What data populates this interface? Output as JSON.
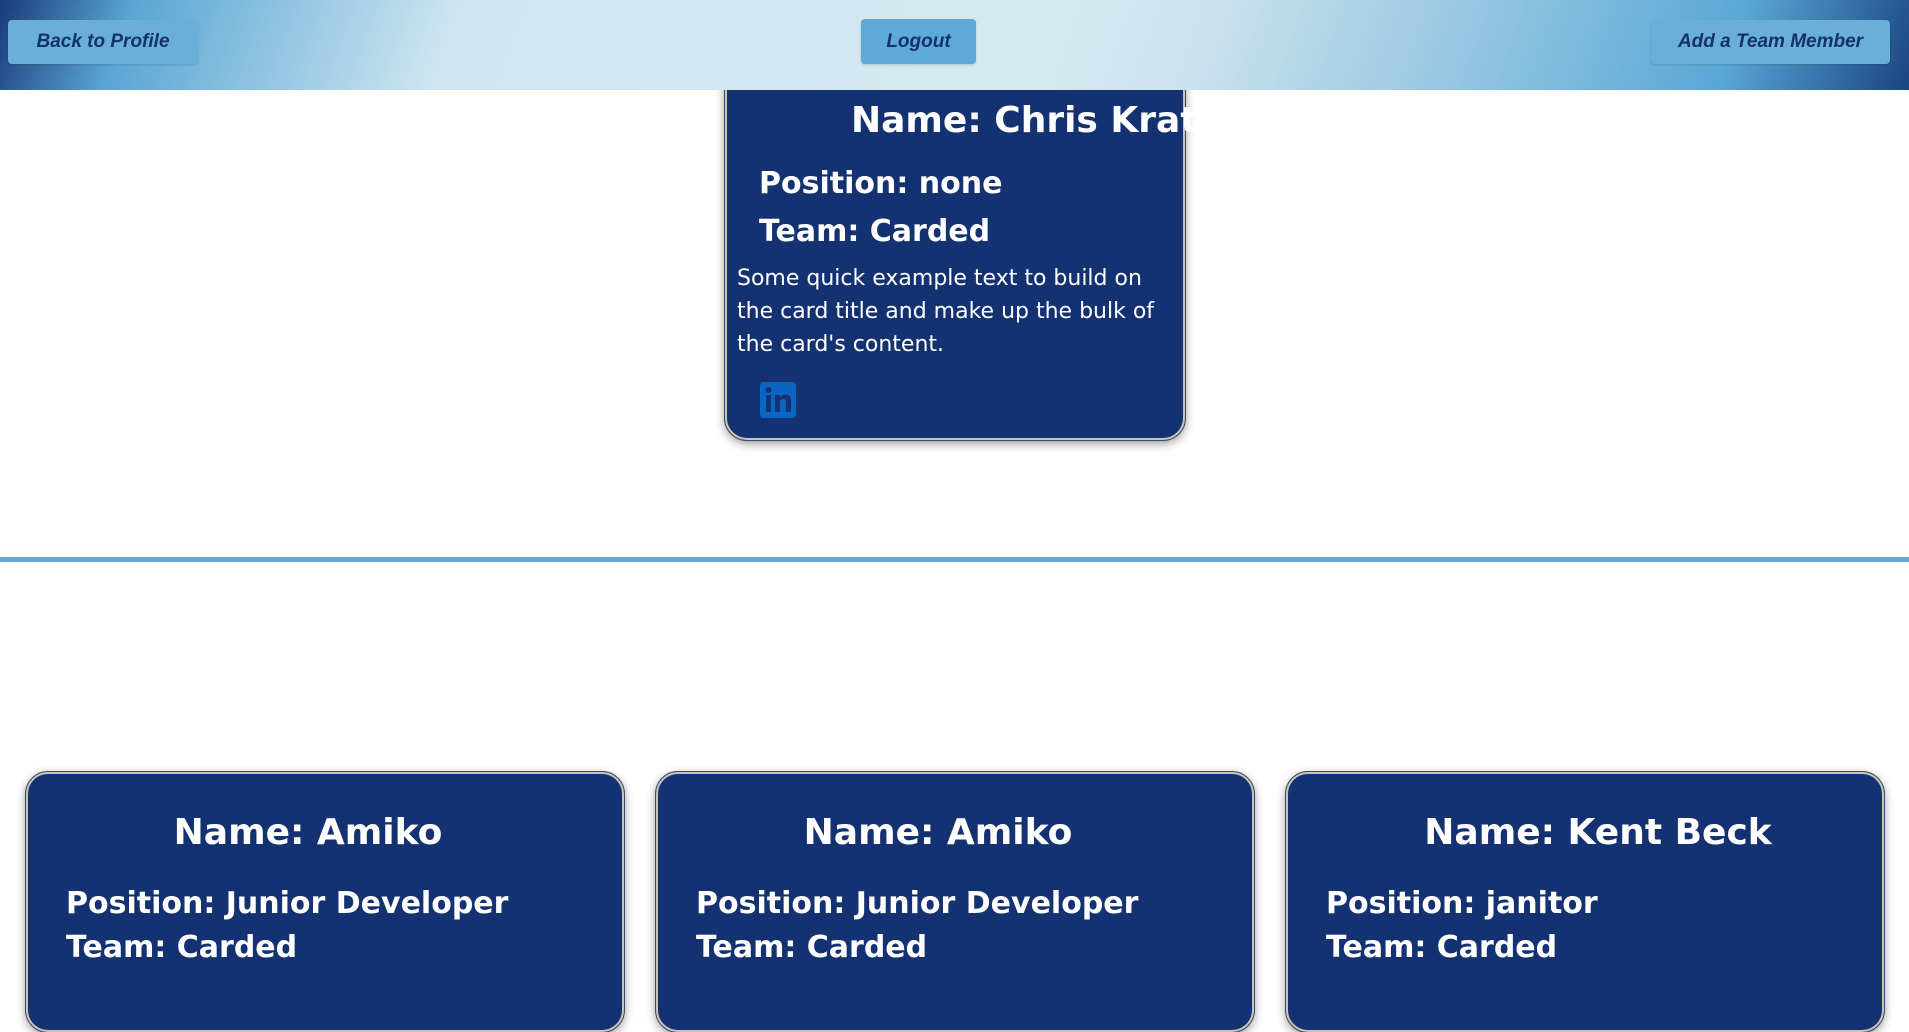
{
  "nav": {
    "back_label": "Back to Profile",
    "logout_label": "Logout",
    "add_label": "Add a Team Member"
  },
  "profile_card": {
    "name": "Name: Chris Kratz",
    "position": "Position: none",
    "team": "Team: Carded",
    "text": "Some quick example text to build on the card title and make up the bulk of the card's content.",
    "icon": "linkedin-icon",
    "icon_color": "#0a66c2"
  },
  "team_members": [
    {
      "name": "Name: Amiko",
      "position": "Position: Junior Developer",
      "team": "Team: Carded"
    },
    {
      "name": "Name: Amiko",
      "position": "Position: Junior Developer",
      "team": "Team: Carded"
    },
    {
      "name": "Name: Kent Beck",
      "position": "Position: janitor",
      "team": "Team: Carded"
    }
  ],
  "colors": {
    "card_bg": "#143272",
    "button_bg": "#6aafd8",
    "button_text": "#14326e",
    "divider": "#6aa7cf"
  }
}
